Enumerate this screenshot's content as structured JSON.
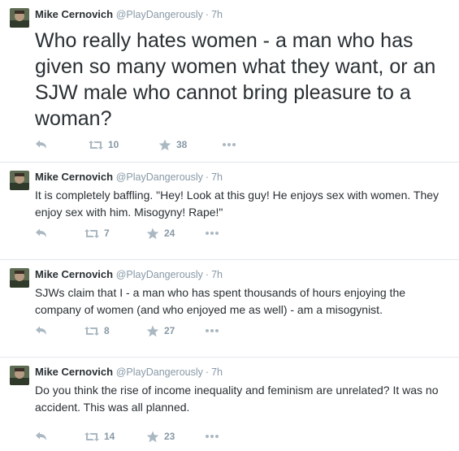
{
  "tweets": [
    {
      "name": "Mike Cernovich",
      "handle": "@PlayDangerously",
      "separator": "·",
      "time": "7h",
      "text": "Who really hates women - a man who has given so many women what they want,  or an SJW male who cannot bring pleasure to a woman?",
      "retweets": "10",
      "favorites": "38",
      "actions": {
        "reply_icon": "reply-arrow-icon",
        "retweet_icon": "retweet-arrows-icon",
        "favorite_icon": "star-icon",
        "more_icon": "ellipsis-icon"
      }
    },
    {
      "name": "Mike Cernovich",
      "handle": "@PlayDangerously",
      "separator": "·",
      "time": "7h",
      "text": "It is completely baffling. \"Hey! Look at this guy! He enjoys sex with women. They enjoy sex with him. Misogyny! Rape!\"",
      "retweets": "7",
      "favorites": "24"
    },
    {
      "name": "Mike Cernovich",
      "handle": "@PlayDangerously",
      "separator": "·",
      "time": "7h",
      "text": "SJWs claim that I - a man who has spent thousands of hours enjoying the company of women (and who enjoyed me as well) - am a misogynist.",
      "retweets": "8",
      "favorites": "27"
    },
    {
      "name": "Mike Cernovich",
      "handle": "@PlayDangerously",
      "separator": "·",
      "time": "7h",
      "text": "Do you think the rise of income inequality and feminism are unrelated? It was no accident. This was all planned.",
      "retweets": "14",
      "favorites": "23"
    }
  ],
  "colors": {
    "text": "#292f33",
    "muted": "#8899a6",
    "icon": "#aab8c2",
    "divider": "#e1e8ed"
  }
}
